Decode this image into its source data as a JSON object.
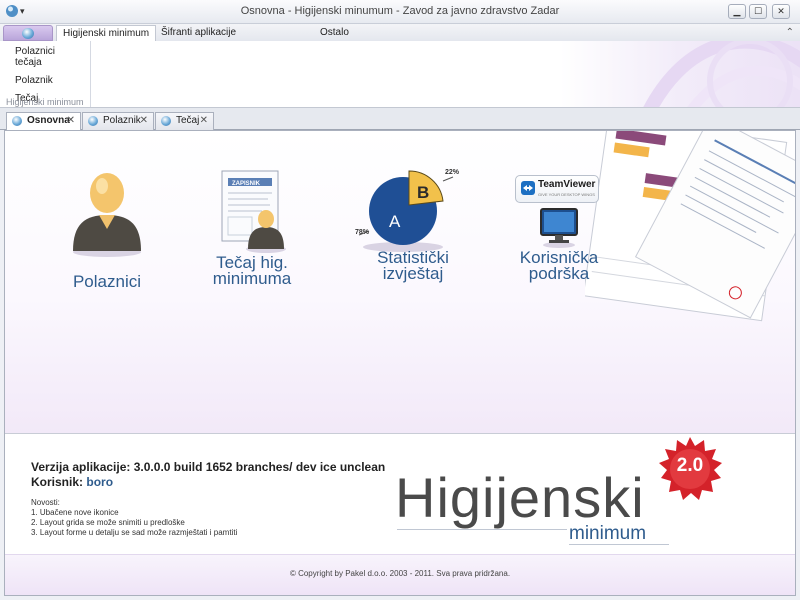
{
  "window": {
    "title": "Osnovna - Higijenski minumum - Zavod za javno zdravstvo Zadar",
    "menu_glyph": "▾",
    "minimize": "▁",
    "maximize": "☐",
    "close": "✕"
  },
  "ribbon": {
    "tabs": [
      {
        "label": "Higijenski minimum",
        "active": true
      },
      {
        "label": "Šifranti aplikacije",
        "active": false
      },
      {
        "label": "Ostalo",
        "active": false
      }
    ],
    "collapse_glyph": "⌃",
    "group": {
      "items": [
        "Polaznici tečaja",
        "Polaznik",
        "Tečaj"
      ],
      "label": "Higijenski minimum"
    }
  },
  "doc_tabs": [
    {
      "label": "Osnovna",
      "active": true,
      "close": "✕"
    },
    {
      "label": "Polaznik",
      "active": false,
      "close": "✕"
    },
    {
      "label": "Tečaj",
      "active": false,
      "close": "✕"
    }
  ],
  "tiles": {
    "polaznici": {
      "line1": "Polaznici",
      "line2": ""
    },
    "tecaj": {
      "line1": "Tečaj hig.",
      "line2": "minimuma",
      "doc_caption": "ZAPISNIK"
    },
    "statisticki": {
      "line1": "Statistički",
      "line2": "izvještaj",
      "pie_a": "A",
      "pie_b": "B",
      "pct_b": "22%",
      "pct_a": "78%"
    },
    "podrska": {
      "line1": "Korisnička",
      "line2": "podrška",
      "brand": "TeamViewer",
      "brand_sub": "GIVE YOUR DESKTOP WINGS"
    }
  },
  "info": {
    "version_label": "Verzija aplikacije:",
    "version_value": "3.0.0.0 build 1652 branches/ dev ice unclean",
    "user_label": "Korisnik:",
    "user_value": "boro",
    "news_title": "Novosti:",
    "news": [
      "1. Ubačene nove ikonice",
      "2. Layout grida se može snimiti u predloške",
      "3. Layout forme u detalju se sad može razmještati i pamtiti"
    ]
  },
  "logo": {
    "main": "Higijenski",
    "sub": "minimum",
    "badge": "2.0"
  },
  "footer": {
    "copyright": "© Copyright by Pakel d.o.o. 2003 - 2011. Sva prava pridržana."
  },
  "colors": {
    "accent_blue": "#2f5c8d",
    "badge_red": "#d4222a"
  }
}
